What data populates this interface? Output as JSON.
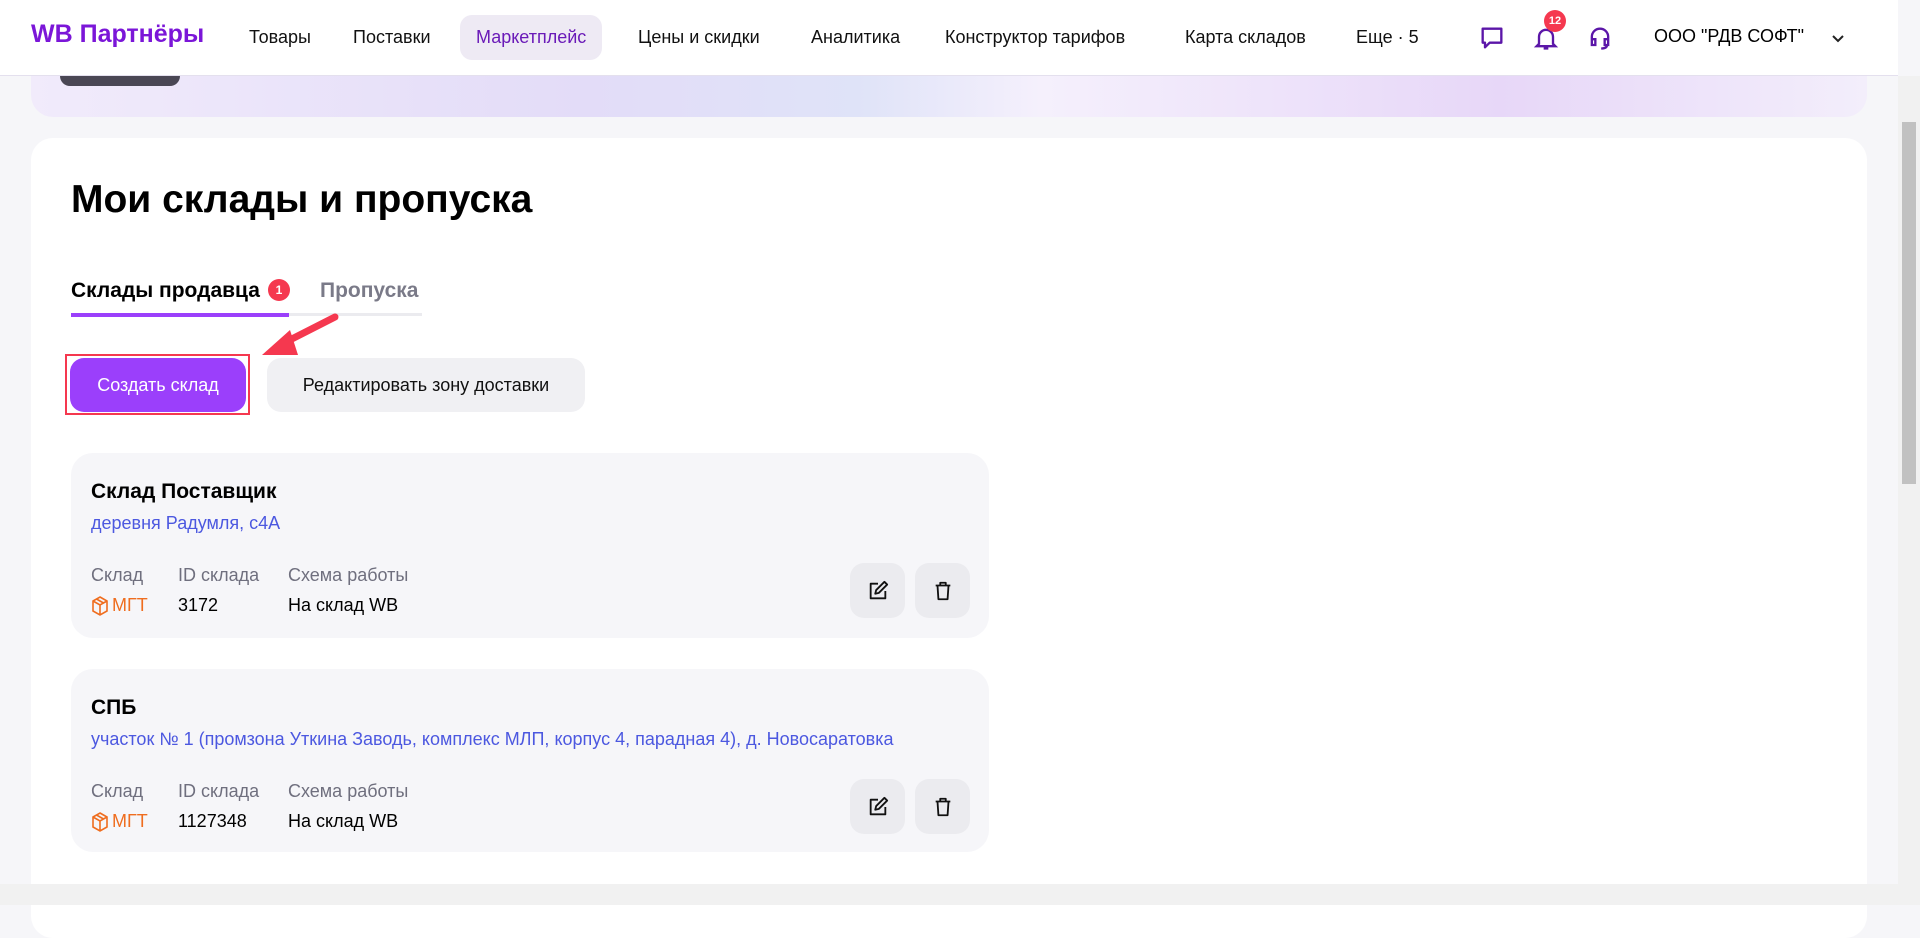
{
  "header": {
    "logo": "WB Партнёры",
    "nav": [
      "Товары",
      "Поставки",
      "Маркетплейс",
      "Цены и скидки",
      "Аналитика",
      "Конструктор тарифов",
      "Карта складов",
      "Еще · 5"
    ],
    "notifications": "12",
    "company": "ООО \"РДВ СОФТ\""
  },
  "page": {
    "title": "Мои склады и пропуска",
    "tabs": [
      {
        "label": "Склады продавца",
        "badge": "1"
      },
      {
        "label": "Пропуска"
      }
    ],
    "create_button": "Создать склад",
    "edit_zone_button": "Редактировать зону доставки"
  },
  "labels": {
    "warehouse": "Склад",
    "id": "ID склада",
    "scheme": "Схема работы"
  },
  "warehouses": [
    {
      "name": "Склад Поставщик",
      "address": "деревня Радумля, с4А",
      "type": "МГТ",
      "id": "3172",
      "scheme": "На склад WB"
    },
    {
      "name": "СПБ",
      "address": "участок № 1 (промзона Уткина Заводь, комплекс МЛП, корпус 4, парадная 4), д. Новосаратовка",
      "type": "МГТ",
      "id": "1127348",
      "scheme": "На склад WB"
    }
  ],
  "colors": {
    "accent": "#9b3ffb",
    "brand": "#7b16d8",
    "badge": "#f5384f",
    "link": "#4c58e0"
  }
}
